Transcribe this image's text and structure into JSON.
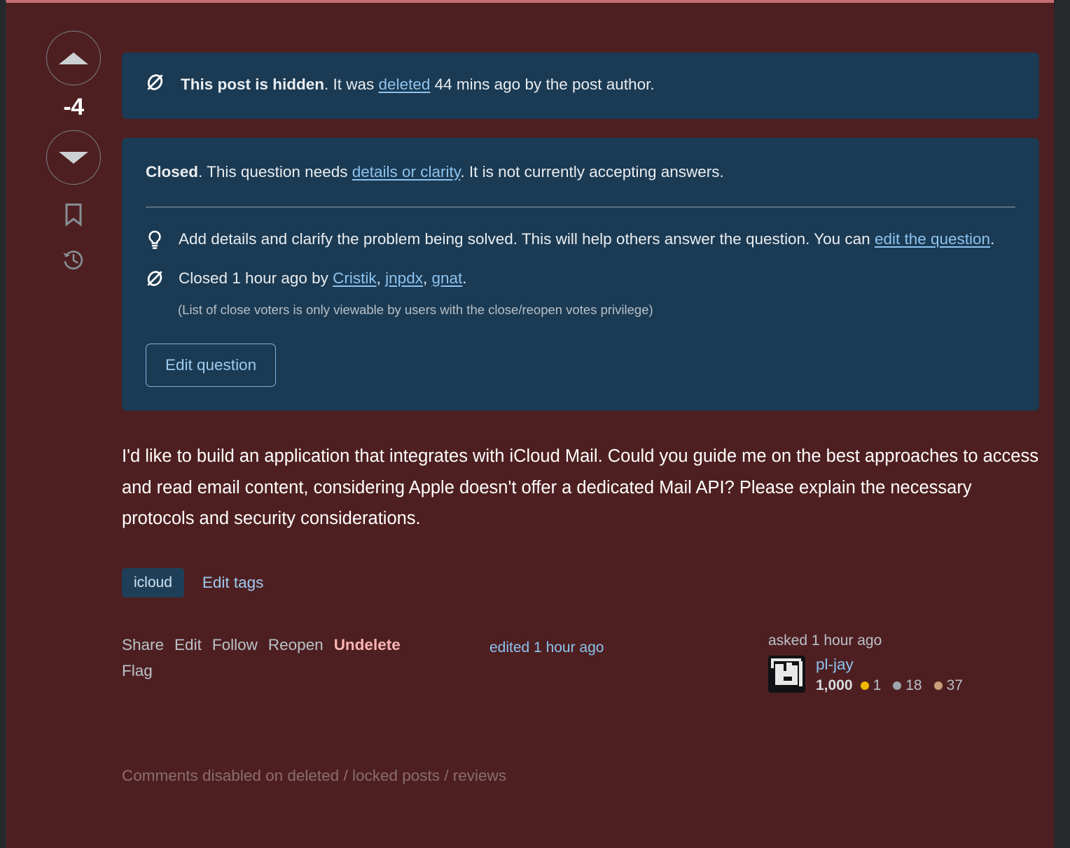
{
  "colors": {
    "deleted_panel_bg": "#4e1f21",
    "panel_top_rule": "#c76e73",
    "notice_bg": "#1b3a53",
    "link": "#8cc3ef",
    "danger": "#fbb5b3",
    "gold_badge": "#f1b600",
    "silver_badge": "#9fa6ad",
    "bronze_badge": "#cb9f78",
    "page_bg": "#26292c"
  },
  "votes": {
    "upvote_label": "Up vote",
    "downvote_label": "Down vote",
    "score": "-4",
    "bookmark_label": "Save",
    "history_label": "Timeline"
  },
  "hidden_notice": {
    "icon": "eye-off-icon",
    "bold_prefix": "This post is hidden",
    "mid_text": ". It was ",
    "link_text": "deleted",
    "suffix_text": " 44 mins ago by the post author."
  },
  "closed_notice": {
    "bold_prefix": "Closed",
    "lead_text": ". This question needs ",
    "reason_link": "details or clarity",
    "lead_tail": ". It is not currently accepting answers.",
    "reasons": [
      {
        "icon": "lightbulb-icon",
        "text_before": "Add details and clarify the problem being solved. This will help others answer the question. You can ",
        "link": "edit the question",
        "text_after": "."
      }
    ],
    "closed_by": {
      "icon": "eye-off-icon",
      "text_before": "Closed 1 hour ago by ",
      "users": [
        "Cristik",
        "jnpdx",
        "gnat"
      ],
      "text_after": "."
    },
    "privilege_note": "(List of close voters is only viewable by users with the close/reopen votes privilege)",
    "edit_button_label": "Edit question"
  },
  "question": {
    "body": "I'd like to build an application that integrates with iCloud Mail. Could you guide me on the best approaches to access and read email content, considering Apple doesn't offer a dedicated Mail API? Please explain the necessary protocols and security considerations."
  },
  "tags": {
    "items": [
      "icloud"
    ],
    "edit_tags_label": "Edit tags"
  },
  "footer": {
    "actions": [
      "Share",
      "Edit",
      "Follow",
      "Reopen"
    ],
    "danger_action": "Undelete",
    "second_row_action": "Flag",
    "edited_stamp": "edited 1 hour ago"
  },
  "user_card": {
    "asked_label": "asked 1 hour ago",
    "username": "pl-jay",
    "reputation": "1,000",
    "badges": {
      "gold": "1",
      "silver": "18",
      "bronze": "37"
    },
    "avatar_alt": "pl-jay avatar"
  },
  "comments": {
    "disabled_text": "Comments disabled on deleted / locked posts / reviews"
  }
}
